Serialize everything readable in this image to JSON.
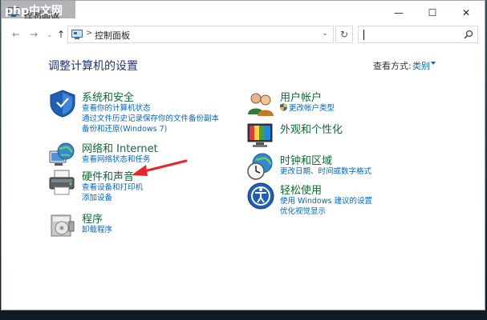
{
  "watermark": {
    "text": "php中文网"
  },
  "window": {
    "title": "控制面板",
    "minimize_symbol": "—",
    "maximize_symbol": "☐",
    "close_symbol": "✕"
  },
  "toolbar": {
    "back_symbol": "←",
    "forward_symbol": "→",
    "recent_symbol": "⌄",
    "up_symbol": "↑",
    "address_separator": ">",
    "address_text": "控制面板",
    "address_dropdown_symbol": "⌄",
    "refresh_symbol": "↻",
    "search_value": ""
  },
  "main": {
    "page_title": "调整计算机的设置",
    "view_by_label": "查看方式:",
    "view_by_value": "类别"
  },
  "categories": {
    "system_security": {
      "title": "系统和安全",
      "links": [
        "查看你的计算机状态",
        "通过文件历史记录保存你的文件备份副本",
        "备份和还原(Windows 7)"
      ]
    },
    "network_internet": {
      "title": "网络和 Internet",
      "links": [
        "查看网络状态和任务"
      ]
    },
    "hardware_sound": {
      "title": "硬件和声音",
      "links": [
        "查看设备和打印机",
        "添加设备"
      ]
    },
    "programs": {
      "title": "程序",
      "links": [
        "卸载程序"
      ]
    },
    "user_accounts": {
      "title": "用户帐户",
      "links": [
        "更改帐户类型"
      ]
    },
    "appearance": {
      "title": "外观和个性化",
      "links": []
    },
    "clock_region": {
      "title": "时钟和区域",
      "links": [
        "更改日期、时间或数字格式"
      ]
    },
    "ease_of_access": {
      "title": "轻松使用",
      "links": [
        "使用 Windows 建议的设置",
        "优化视觉显示"
      ]
    }
  },
  "colors": {
    "category_title": "#0b6d32",
    "link": "#0066cc",
    "page_title": "#1e3287",
    "annotation_arrow": "#e8262a"
  }
}
